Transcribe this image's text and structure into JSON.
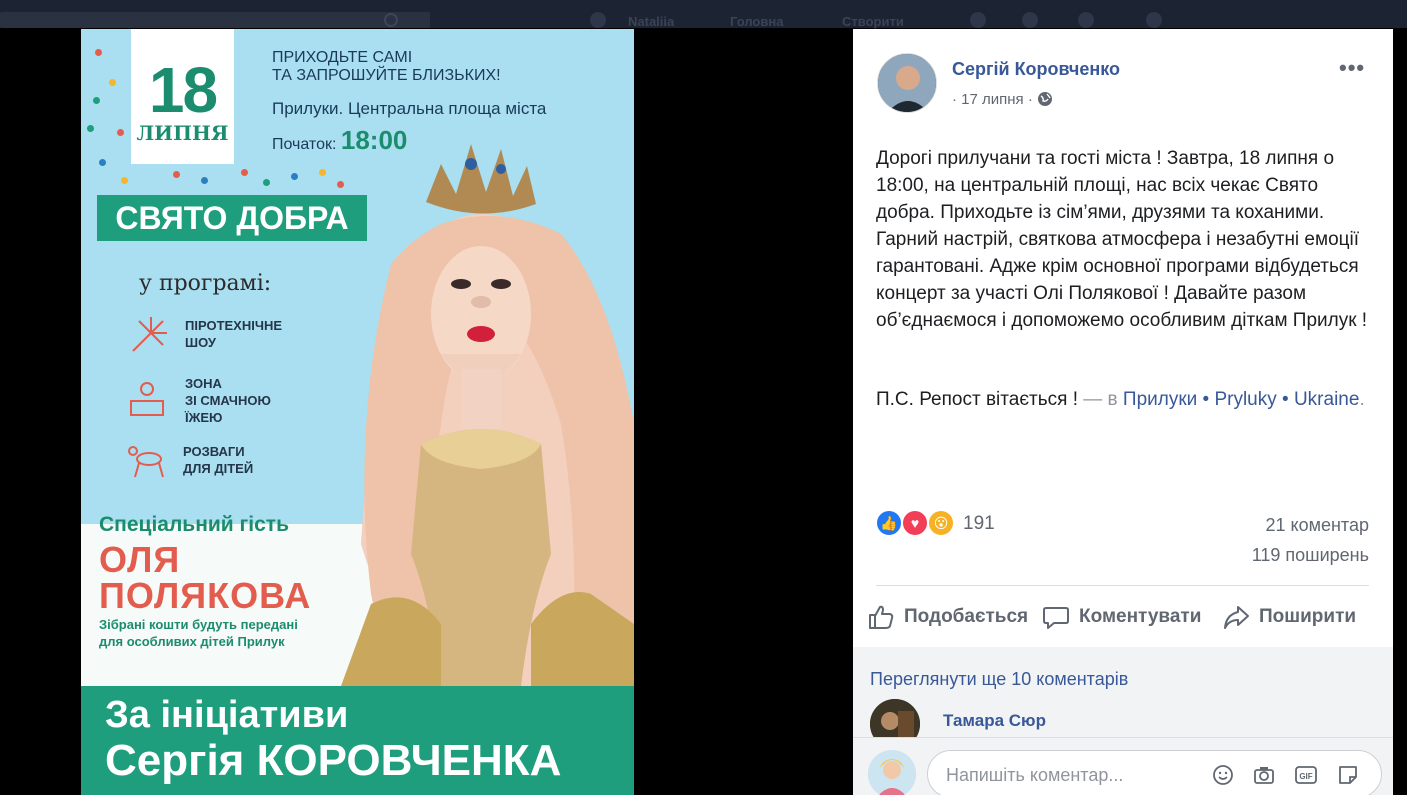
{
  "nav": {
    "search_placeholder": "",
    "user_name": "Nataliia",
    "home_label": "Головна",
    "create_label": "Створити"
  },
  "poster": {
    "date_day": "18",
    "date_month": "ЛИПНЯ",
    "invite_line1": "ПРИХОДЬТЕ САМІ",
    "invite_line2": "ТА ЗАПРОШУЙТЕ БЛИЗЬКИХ!",
    "location": "Прилуки. Центральна площа міста",
    "start_label": "Початок:",
    "start_time": "18:00",
    "holiday_title": "СВЯТО ДОБРА",
    "program_title": "у програмі:",
    "program_items": [
      {
        "line1": "ПІРОТЕХНІЧНЕ",
        "line2": "ШОУ",
        "line3": ""
      },
      {
        "line1": "ЗОНА",
        "line2": "ЗІ СМАЧНОЮ",
        "line3": "ЇЖЕЮ"
      },
      {
        "line1": "РОЗВАГИ",
        "line2": "ДЛЯ ДІТЕЙ",
        "line3": ""
      }
    ],
    "guest_label": "Спеціальний гість",
    "guest_first": "ОЛЯ",
    "guest_last": "ПОЛЯКОВА",
    "guest_note_line1": "Зібрані кошти будуть передані",
    "guest_note_line2": "для особливих дітей Прилук",
    "footer_line1": "За ініціативи",
    "footer_line2": "Сергія КОРОВЧЕНКА"
  },
  "post": {
    "author": "Сергій Коровченко",
    "date": "17 липня",
    "more_label": "•••",
    "body": "Дорогі прилучани та гості міста ! Завтра, 18 липня о 18:00, на центральній площі, нас всіх чекає Свято добра. Приходьте із сім’ями, друзями та коханими. Гарний настрій, святкова атмосфера і незабутні емоції гарантовані. Адже крім основної програми відбудеться концерт за участі Олі Полякової ! Давайте разом об’єднаємося і допоможемо особливим діткам Прилук !",
    "ps_text": "П.С. Репост вітається !",
    "ps_in": " — в ",
    "place_link": "Прилуки • Pryluky • Ukraine",
    "place_end": ".",
    "reactions": {
      "count": "191",
      "types": [
        "like",
        "love",
        "wow"
      ]
    },
    "comments_count": "21 коментар",
    "shares_count": "119 поширень",
    "actions": {
      "like": "Подобається",
      "comment": "Коментувати",
      "share": "Поширити"
    },
    "more_comments": "Переглянути ще 10 коментарів",
    "commenter": "Тамара Сюр",
    "composer_placeholder": "Напишіть коментар..."
  },
  "colors": {
    "poster_sky": "#a9dff0",
    "poster_green": "#1f9e7d",
    "poster_red": "#e35d4e",
    "fb_link": "#385898",
    "fb_text": "#1c1e21",
    "fb_muted": "#606770"
  }
}
